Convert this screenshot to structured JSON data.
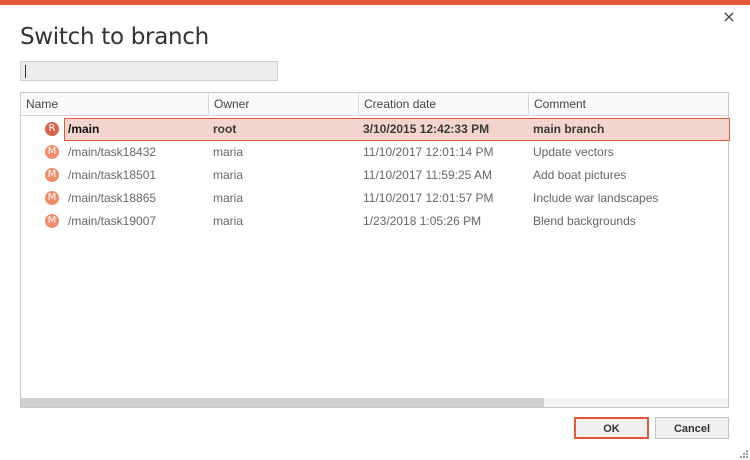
{
  "dialog": {
    "title": "Switch to branch",
    "accent_color": "#e1583a",
    "close_icon": "×"
  },
  "search": {
    "value": "",
    "placeholder": ""
  },
  "table": {
    "columns": [
      "Name",
      "Owner",
      "Creation date",
      "Comment"
    ],
    "rows": [
      {
        "avatar": "R",
        "avatar_color": "#d9634e",
        "name": "/main",
        "owner": "root",
        "created": "3/10/2015 12:42:33 PM",
        "comment": "main branch"
      },
      {
        "avatar": "M",
        "avatar_color": "#f08e6b",
        "name": "/main/task18432",
        "owner": "maria",
        "created": "11/10/2017 12:01:14 PM",
        "comment": "Update vectors"
      },
      {
        "avatar": "M",
        "avatar_color": "#f08e6b",
        "name": "/main/task18501",
        "owner": "maria",
        "created": "11/10/2017 11:59:25 AM",
        "comment": "Add boat pictures"
      },
      {
        "avatar": "M",
        "avatar_color": "#f08e6b",
        "name": "/main/task18865",
        "owner": "maria",
        "created": "11/10/2017 12:01:57 PM",
        "comment": "Include war landscapes"
      },
      {
        "avatar": "M",
        "avatar_color": "#f08e6b",
        "name": "/main/task19007",
        "owner": "maria",
        "created": "1/23/2018 1:05:26 PM",
        "comment": "Blend backgrounds"
      }
    ],
    "selected_row": 0
  },
  "buttons": {
    "ok": "OK",
    "cancel": "Cancel"
  }
}
